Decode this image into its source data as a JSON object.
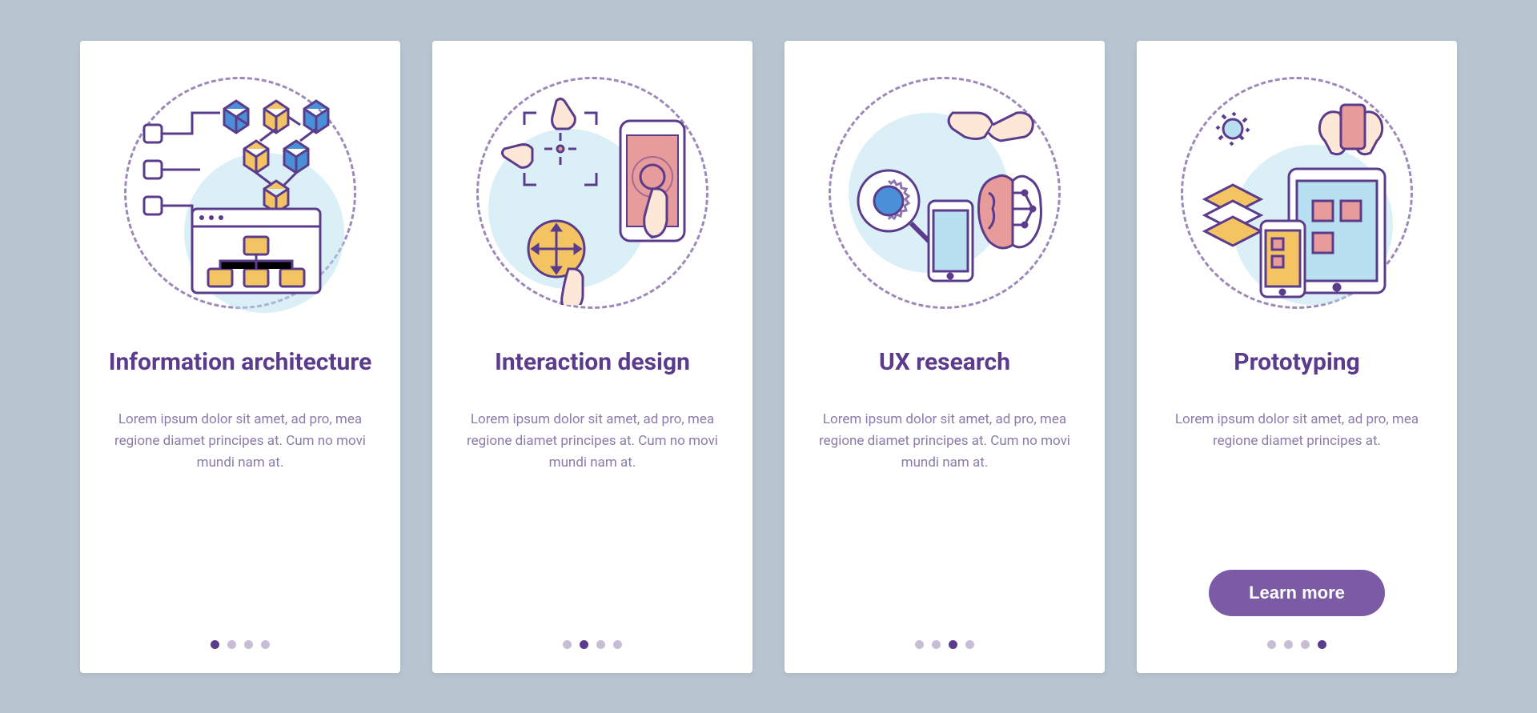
{
  "cards": [
    {
      "title": "Information architecture",
      "description": "Lorem ipsum dolor sit amet, ad pro, mea regione diamet principes at. Cum no movi mundi nam at."
    },
    {
      "title": "Interaction design",
      "description": "Lorem ipsum dolor sit amet, ad pro, mea regione diamet principes at. Cum no movi mundi nam at."
    },
    {
      "title": "UX research",
      "description": "Lorem ipsum dolor sit amet, ad pro, mea regione diamet principes at. Cum no movi mundi nam at."
    },
    {
      "title": "Prototyping",
      "description": "Lorem ipsum dolor sit amet, ad pro, mea regione diamet principes at.",
      "cta": "Learn more"
    }
  ],
  "colors": {
    "purple": "#5b3c8c",
    "lightPurple": "#8a7ba8",
    "blue": "#4a90d9",
    "yellow": "#f4c463",
    "pink": "#e89b9b",
    "lightBlue": "#b8e0f0"
  }
}
